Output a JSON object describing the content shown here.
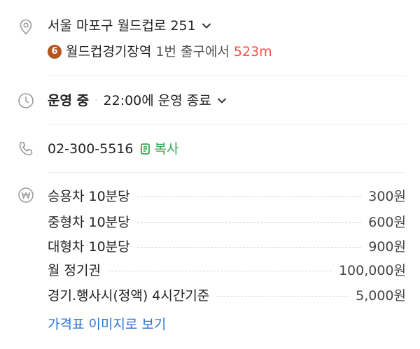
{
  "address": {
    "text": "서울 마포구 월드컵로 251",
    "icon": "location-pin-icon",
    "subway": {
      "line_number": "6",
      "line_color": "#b5561f",
      "station": "월드컵경기장역",
      "exit_text": "1번 출구에서",
      "distance": "523m"
    }
  },
  "hours": {
    "icon": "clock-icon",
    "status": "운영 중",
    "separator": "·",
    "detail": "22:00에 운영 종료"
  },
  "phone": {
    "icon": "phone-icon",
    "number": "02-300-5516",
    "copy_label": "복사"
  },
  "pricing": {
    "icon": "won-currency-icon",
    "items": [
      {
        "name": "승용차 10분당",
        "price": "300원"
      },
      {
        "name": "중형차 10분당",
        "price": "600원"
      },
      {
        "name": "대형차 10분당",
        "price": "900원"
      },
      {
        "name": "월 정기권",
        "price": "100,000원"
      },
      {
        "name": "경기.행사시(정액) 4시간기준",
        "price": "5,000원"
      }
    ],
    "image_link": "가격표 이미지로 보기"
  }
}
